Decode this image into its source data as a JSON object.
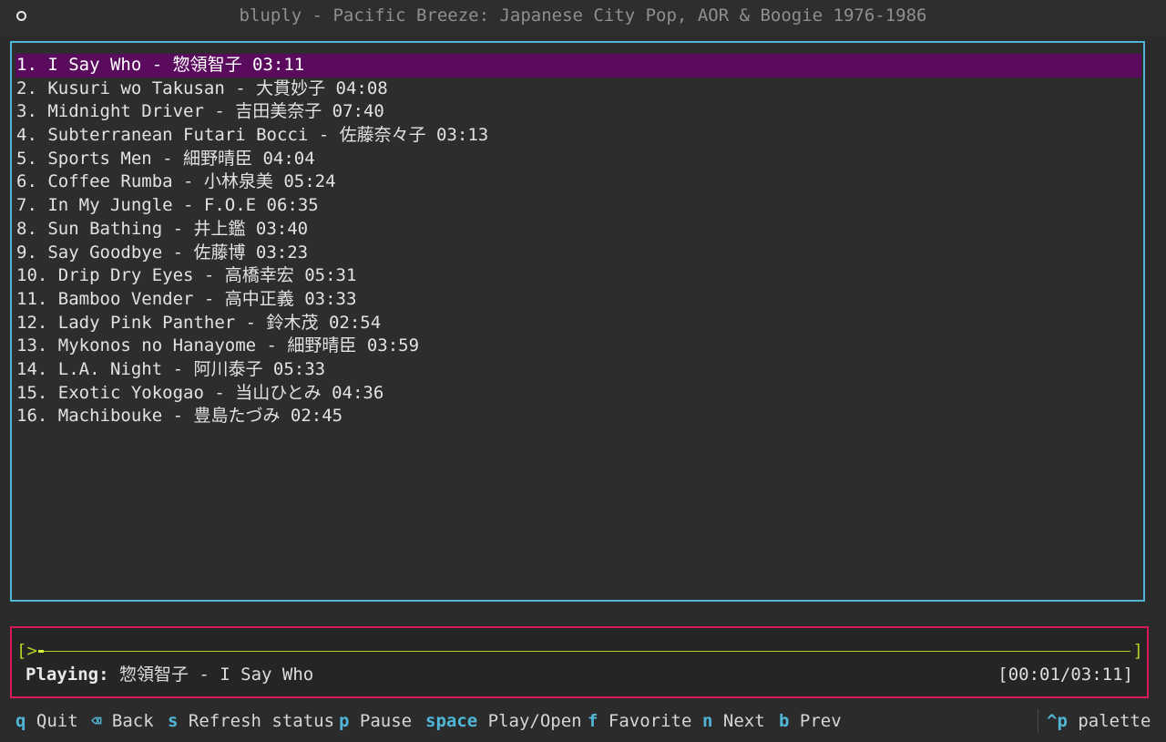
{
  "window": {
    "title": "bluply - Pacific Breeze: Japanese City Pop, AOR & Boogie 1976-1986"
  },
  "tracks": [
    "1. I Say Who - 惣領智子 03:11",
    "2. Kusuri wo Takusan - 大貫妙子 04:08",
    "3. Midnight Driver - 吉田美奈子 07:40",
    "4. Subterranean Futari Bocci - 佐藤奈々子 03:13",
    "5. Sports Men - 細野晴臣 04:04",
    "6. Coffee Rumba - 小林泉美 05:24",
    "7. In My Jungle - F.O.E 06:35",
    "8. Sun Bathing - 井上鑑 03:40",
    "9. Say Goodbye - 佐藤博 03:23",
    "10. Drip Dry Eyes - 高橋幸宏 05:31",
    "11. Bamboo Vender - 高中正義 03:33",
    "12. Lady Pink Panther - 鈴木茂 02:54",
    "13. Mykonos no Hanayome - 細野晴臣 03:59",
    "14. L.A. Night - 阿川泰子 05:33",
    "15. Exotic Yokogao - 当山ひとみ 04:36",
    "16. Machibouke - 豊島たづみ 02:45"
  ],
  "selected_index": 0,
  "player": {
    "progress_open": "[>",
    "progress_close": "]",
    "progress_fraction": 0.005,
    "playing_label": "Playing:",
    "playing_text": "惣領智子 - I Say Who",
    "time": "[00:01/03:11]"
  },
  "footer": {
    "shortcuts": [
      {
        "key": "q",
        "label": "Quit"
      },
      {
        "key": "⌫",
        "label": "Back"
      },
      {
        "key": "s",
        "label": "Refresh status"
      },
      {
        "key": "p",
        "label": "Pause"
      },
      {
        "key": "space",
        "label": "Play/Open"
      },
      {
        "key": "f",
        "label": "Favorite"
      },
      {
        "key": "n",
        "label": "Next"
      },
      {
        "key": "b",
        "label": "Prev"
      }
    ],
    "palette": {
      "key": "^p",
      "label": "palette"
    }
  },
  "colors": {
    "list_border": "#4fb6d6",
    "player_border": "#d81b54",
    "selection": "#5a0b5e",
    "progress": "#b5cf2a",
    "key_accent": "#4fb6d6"
  }
}
